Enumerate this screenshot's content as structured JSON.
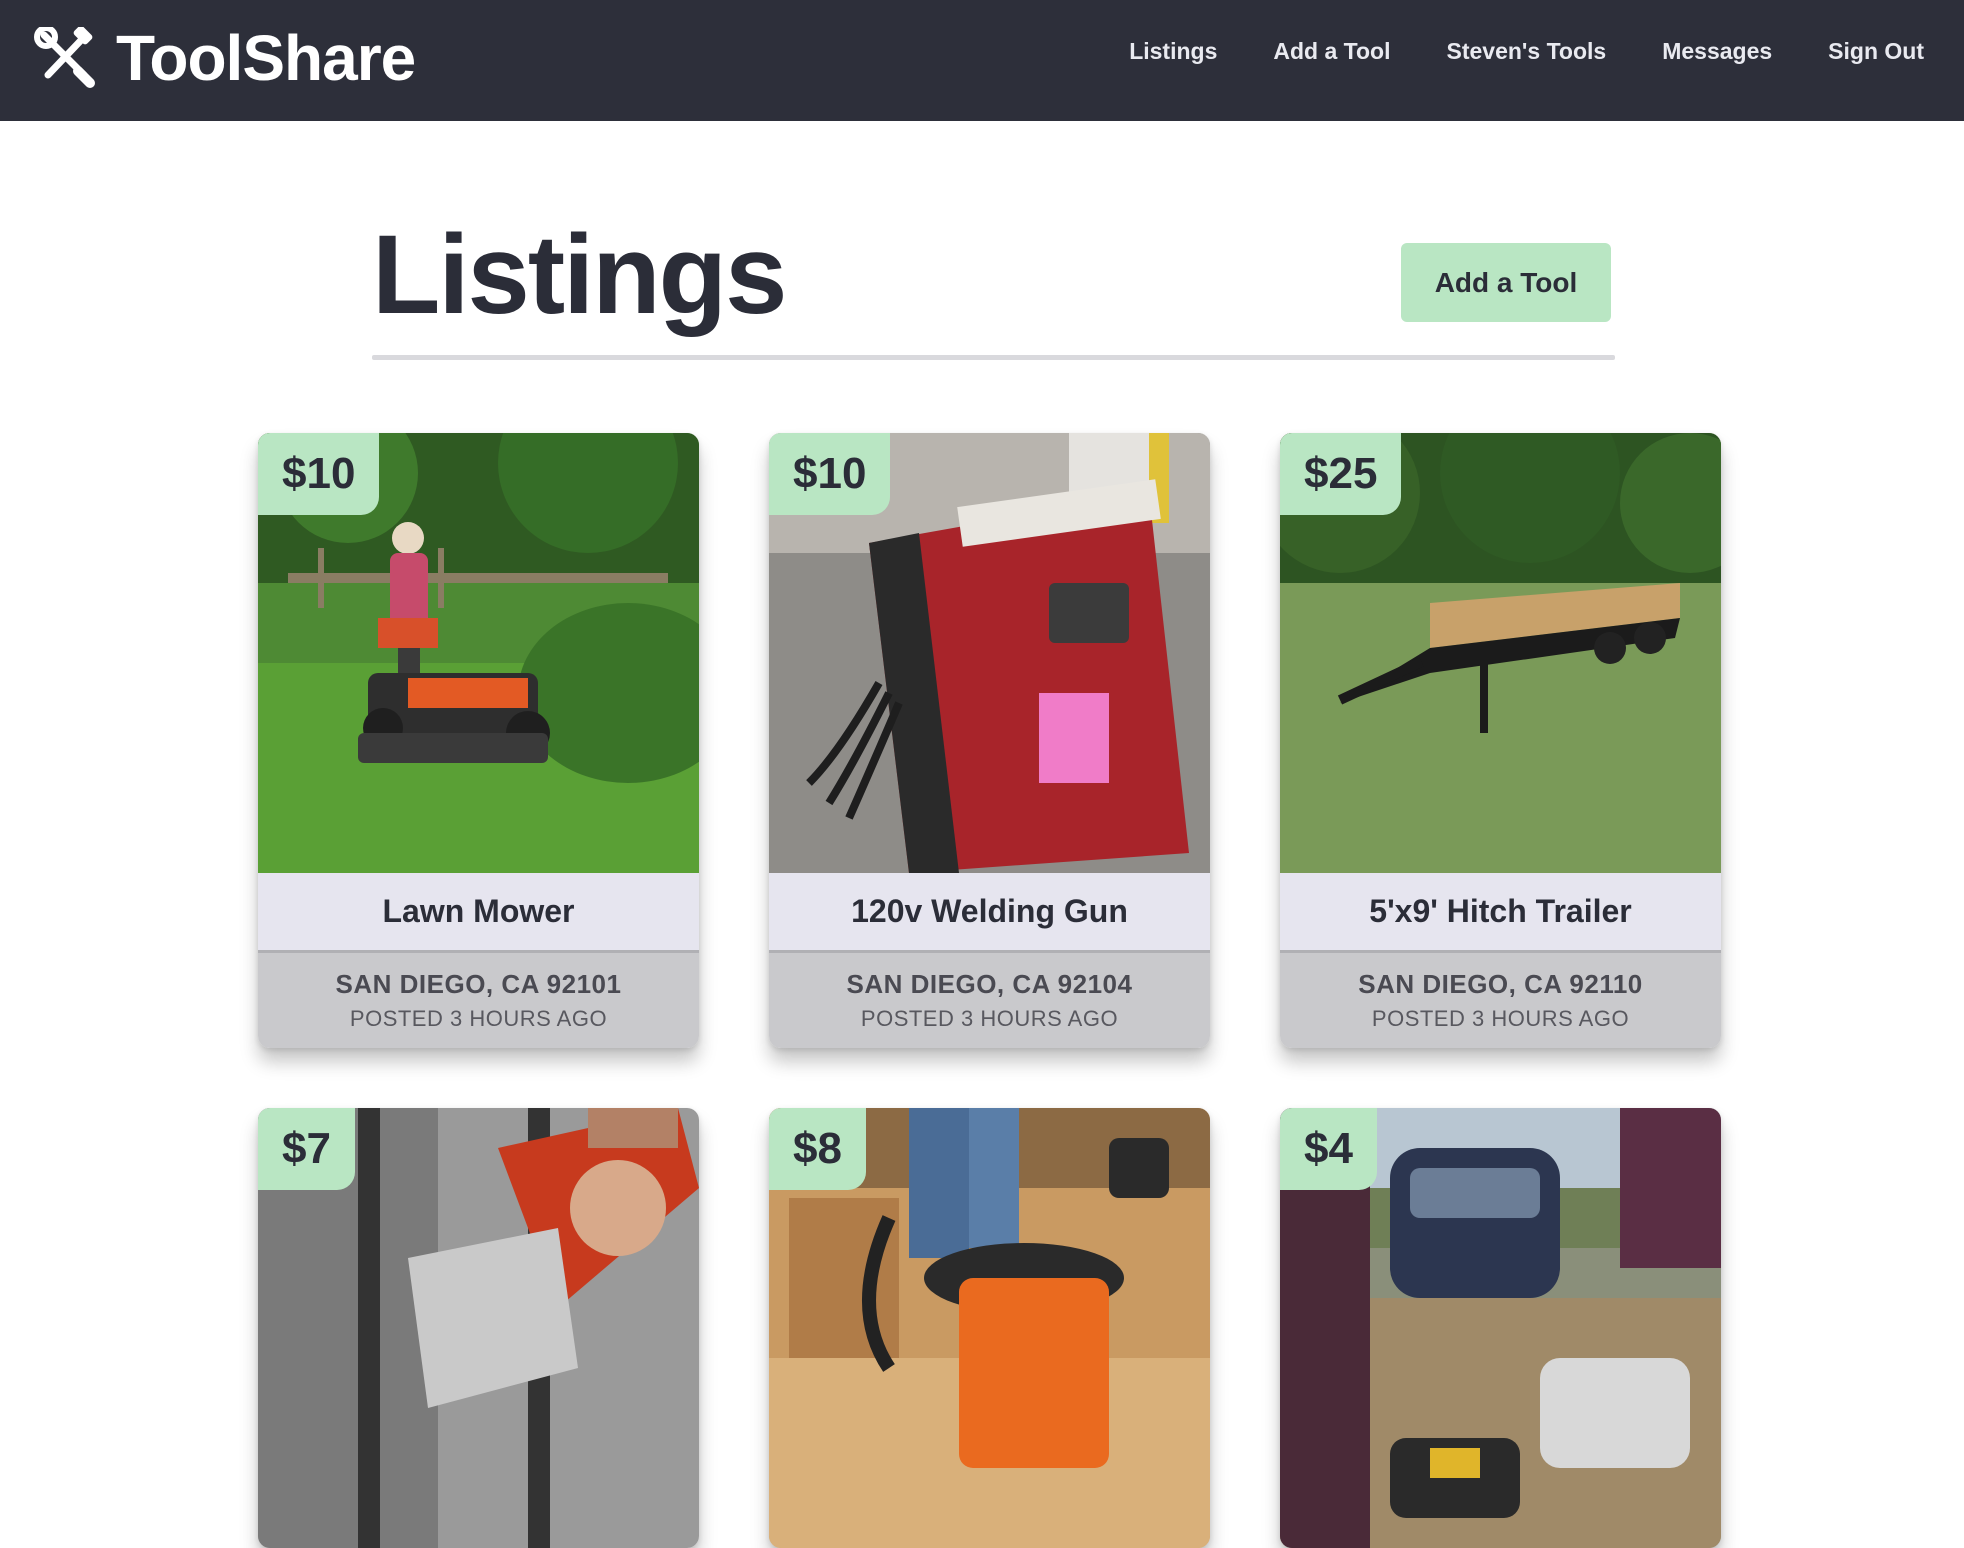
{
  "app": {
    "name": "ToolShare",
    "logo_icon": "crossed-tools-icon"
  },
  "nav": {
    "links": [
      {
        "label": "Listings"
      },
      {
        "label": "Add a Tool"
      },
      {
        "label": "Steven's Tools"
      },
      {
        "label": "Messages"
      },
      {
        "label": "Sign Out"
      }
    ]
  },
  "header": {
    "title": "Listings",
    "add_button_label": "Add a Tool"
  },
  "colors": {
    "navbar": "#2d2f3a",
    "accent_green": "#b9e6c3",
    "card_title_bg": "#e6e5ef",
    "card_meta_bg": "#c9c9cc"
  },
  "listings": [
    {
      "price": "$10",
      "title": "Lawn Mower",
      "location": "San Diego, CA 92101",
      "posted": "Posted 3 hours ago",
      "image": "lawn-mower-photo"
    },
    {
      "price": "$10",
      "title": "120v Welding Gun",
      "location": "San Diego, CA 92104",
      "posted": "Posted 3 hours ago",
      "image": "welder-photo"
    },
    {
      "price": "$25",
      "title": "5'x9' Hitch Trailer",
      "location": "San Diego, CA 92110",
      "posted": "Posted 3 hours ago",
      "image": "trailer-photo"
    },
    {
      "price": "$7",
      "image": "angle-grinder-photo"
    },
    {
      "price": "$8",
      "image": "shop-vac-photo"
    },
    {
      "price": "$4",
      "image": "winch-photo"
    }
  ]
}
